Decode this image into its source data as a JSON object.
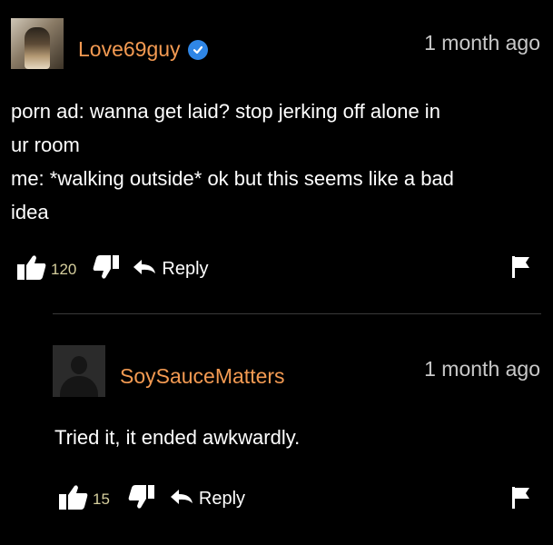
{
  "comments": [
    {
      "username": "Love69guy",
      "timestamp": "1 month ago",
      "text_lines": [
        "porn ad: wanna get laid? stop jerking off alone in",
        "ur room",
        "me: *walking outside* ok but this seems like a bad",
        "idea"
      ],
      "likes": "120",
      "reply_label": "Reply",
      "verified": true
    },
    {
      "username": "SoySauceMatters",
      "timestamp": "1 month ago",
      "text_lines": [
        "Tried it, it ended awkwardly."
      ],
      "likes": "15",
      "reply_label": "Reply",
      "verified": false
    }
  ],
  "colors": {
    "background": "#000000",
    "username": "#f39a52",
    "verified": "#2f86e6",
    "like_count": "#d6cf9e"
  },
  "icons": [
    "thumbs-up-icon",
    "thumbs-down-icon",
    "reply-arrow-icon",
    "flag-icon",
    "verified-check-icon"
  ]
}
